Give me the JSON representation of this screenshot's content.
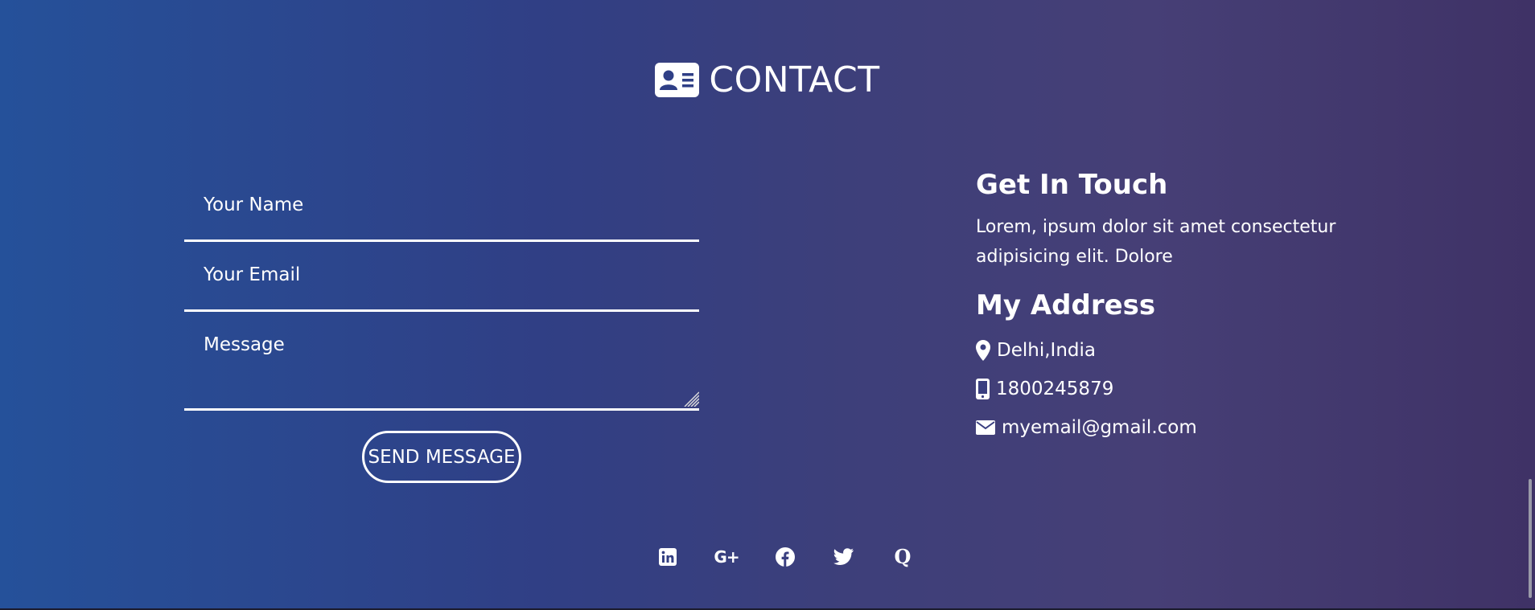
{
  "header": {
    "title": "CONTACT",
    "icon": "id-card-icon"
  },
  "form": {
    "name_placeholder": "Your Name",
    "email_placeholder": "Your Email",
    "message_placeholder": "Message",
    "send_label": "SEND MESSAGE"
  },
  "info": {
    "touch_heading": "Get In Touch",
    "touch_text": "Lorem, ipsum dolor sit amet consectetur adipisicing elit. Dolore",
    "address_heading": "My Address",
    "location": "Delhi,India",
    "phone": "1800245879",
    "email": "myemail@gmail.com"
  },
  "social": {
    "icons": [
      "linkedin-icon",
      "google-plus-icon",
      "facebook-icon",
      "twitter-icon",
      "quora-icon"
    ],
    "google_plus_glyph": "G+",
    "quora_glyph": "Q"
  },
  "colors": {
    "gradient_start": "#25519a",
    "gradient_end": "#3f3266",
    "text": "#ffffff"
  }
}
